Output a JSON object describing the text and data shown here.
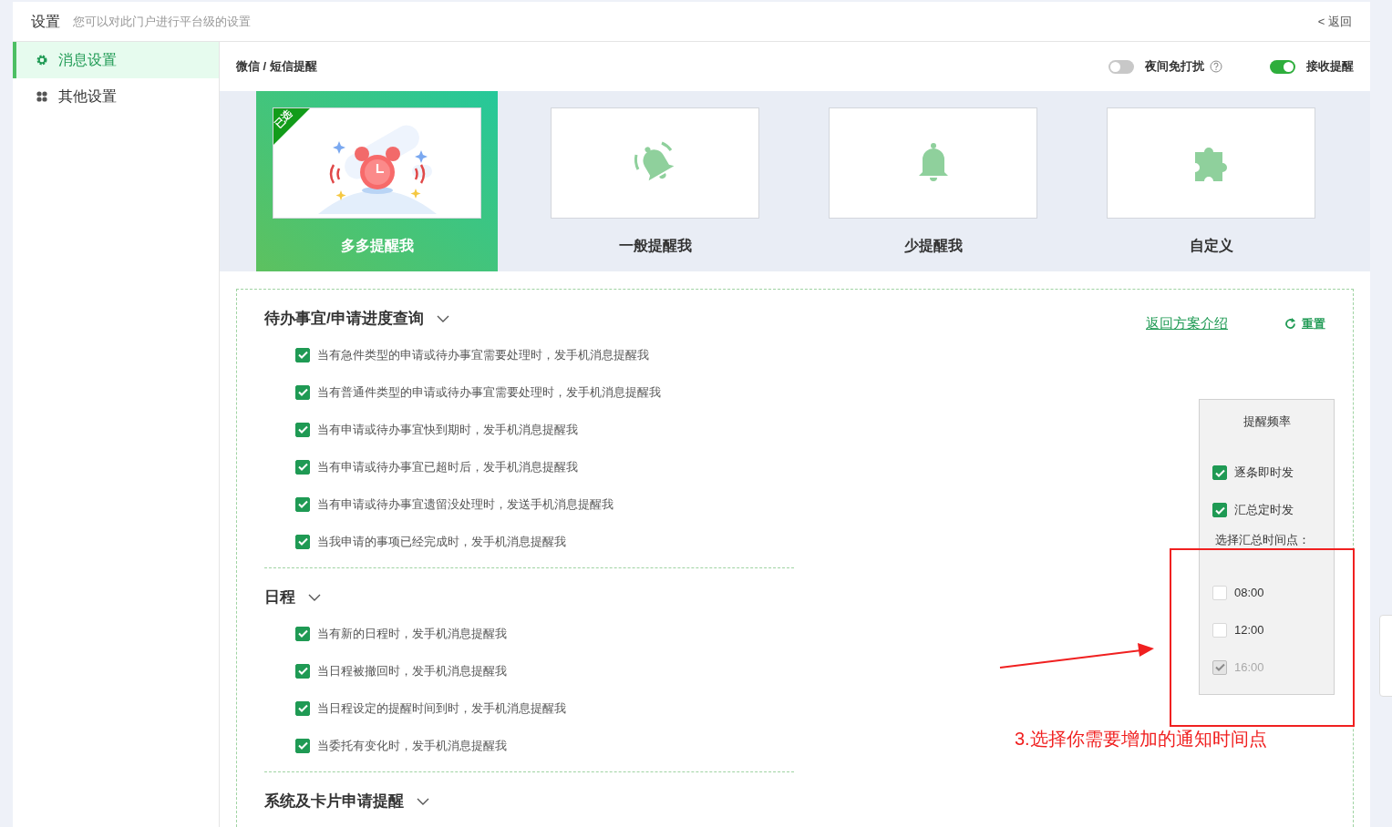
{
  "header": {
    "title": "设置",
    "subtitle": "您可以对此门户进行平台级的设置",
    "back_link": "< 返回"
  },
  "sidebar": {
    "items": [
      {
        "label": "消息设置",
        "selected": true
      },
      {
        "label": "其他设置",
        "selected": false
      }
    ]
  },
  "subheader": {
    "breadcrumb": "微信 / 短信提醒",
    "toggles": [
      {
        "label": "夜间免打扰",
        "on": false,
        "help": true
      },
      {
        "label": "接收提醒",
        "on": true
      }
    ]
  },
  "plans": [
    {
      "label": "多多提醒我",
      "selected": true,
      "badge": "已选"
    },
    {
      "label": "一般提醒我",
      "selected": false
    },
    {
      "label": "少提醒我",
      "selected": false
    },
    {
      "label": "自定义",
      "selected": false
    }
  ],
  "actions": {
    "back_link": "返回方案介绍",
    "reset": "重置"
  },
  "sections": [
    {
      "title": "待办事宜/申请进度查询",
      "expanded": true,
      "items": [
        {
          "label": "当有急件类型的申请或待办事宜需要处理时，发手机消息提醒我",
          "checked": true
        },
        {
          "label": "当有普通件类型的申请或待办事宜需要处理时，发手机消息提醒我",
          "checked": true
        },
        {
          "label": "当有申请或待办事宜快到期时，发手机消息提醒我",
          "checked": true
        },
        {
          "label": "当有申请或待办事宜已超时后，发手机消息提醒我",
          "checked": true
        },
        {
          "label": "当有申请或待办事宜遗留没处理时，发送手机消息提醒我",
          "checked": true
        },
        {
          "label": "当我申请的事项已经完成时，发手机消息提醒我",
          "checked": true
        }
      ]
    },
    {
      "title": "日程",
      "expanded": true,
      "items": [
        {
          "label": "当有新的日程时，发手机消息提醒我",
          "checked": true
        },
        {
          "label": "当日程被撤回时，发手机消息提醒我",
          "checked": true
        },
        {
          "label": "当日程设定的提醒时间到时，发手机消息提醒我",
          "checked": true
        },
        {
          "label": "当委托有变化时，发手机消息提醒我",
          "checked": true
        }
      ]
    },
    {
      "title": "系统及卡片申请提醒",
      "expanded": true
    }
  ],
  "frequency": {
    "title": "提醒频率",
    "options": [
      {
        "label": "逐条即时发",
        "checked": true
      },
      {
        "label": "汇总定时发",
        "checked": true
      }
    ],
    "time_label": "选择汇总时间点：",
    "times": [
      {
        "label": "08:00",
        "checked": false,
        "disabled": false
      },
      {
        "label": "12:00",
        "checked": false,
        "disabled": false
      },
      {
        "label": "16:00",
        "checked": true,
        "disabled": true
      }
    ]
  },
  "annotation": {
    "text": "3.选择你需要增加的通知时间点"
  }
}
